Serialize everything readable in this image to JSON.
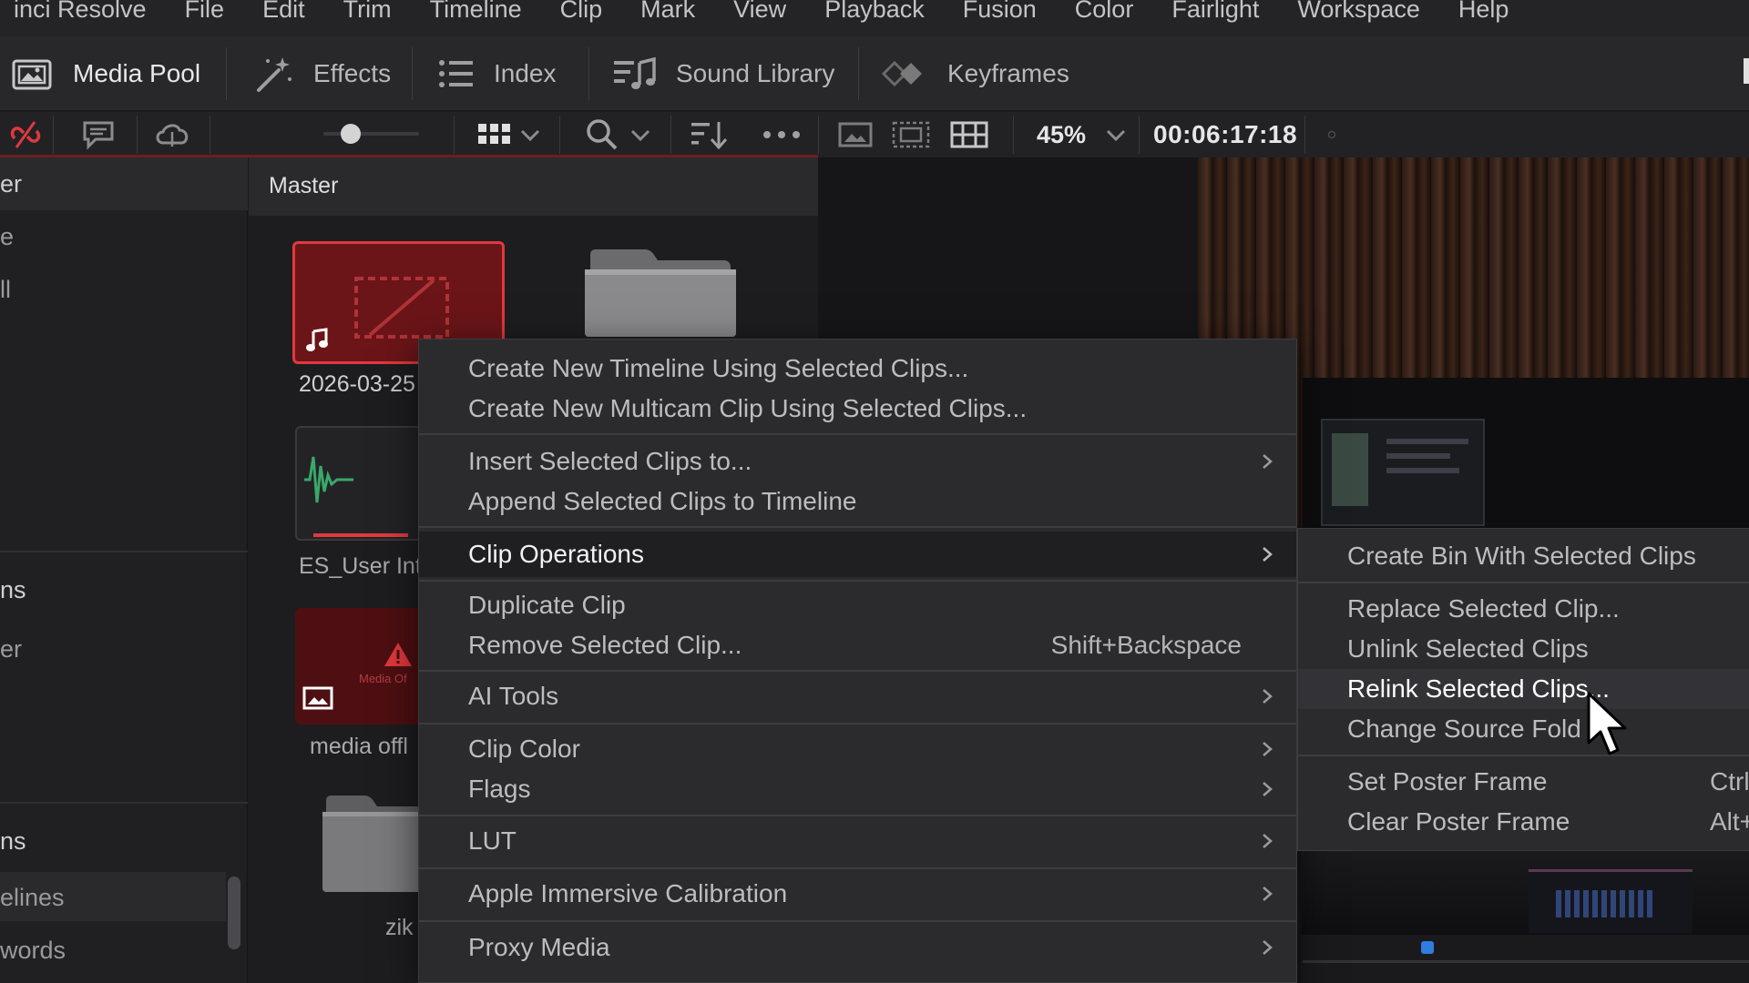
{
  "menubar": {
    "items": [
      "inci Resolve",
      "File",
      "Edit",
      "Trim",
      "Timeline",
      "Clip",
      "Mark",
      "View",
      "Playback",
      "Fusion",
      "Color",
      "Fairlight",
      "Workspace",
      "Help"
    ]
  },
  "toolbar": {
    "media_pool": "Media Pool",
    "effects": "Effects",
    "index": "Index",
    "sound_library": "Sound Library",
    "keyframes": "Keyframes"
  },
  "subbar": {
    "zoom": "45%",
    "timecode": "00:06:17:18"
  },
  "sidebar": {
    "texts": [
      "er",
      "e",
      "ll",
      "ns",
      "er",
      "ns",
      "elines",
      "words"
    ]
  },
  "pool": {
    "title": "Master",
    "clips": [
      {
        "label": "2026-03-25"
      },
      {
        "label": "ES_User Int"
      },
      {
        "label": "media offl"
      },
      {
        "label": "zik"
      }
    ],
    "offline_text": "Media Of"
  },
  "context_menu": {
    "items": [
      {
        "label": "Create New Timeline Using Selected Clips...",
        "shortcut": "",
        "submenu": false
      },
      {
        "label": "Create New Multicam Clip Using Selected Clips...",
        "shortcut": "",
        "submenu": false
      },
      {
        "label": "Insert Selected Clips to...",
        "shortcut": "",
        "submenu": true
      },
      {
        "label": "Append Selected Clips to Timeline",
        "shortcut": "",
        "submenu": false
      },
      {
        "label": "Clip Operations",
        "shortcut": "",
        "submenu": true
      },
      {
        "label": "Duplicate Clip",
        "shortcut": "",
        "submenu": false
      },
      {
        "label": "Remove Selected Clip...",
        "shortcut": "Shift+Backspace",
        "submenu": false
      },
      {
        "label": "AI Tools",
        "shortcut": "",
        "submenu": true
      },
      {
        "label": "Clip Color",
        "shortcut": "",
        "submenu": true
      },
      {
        "label": "Flags",
        "shortcut": "",
        "submenu": true
      },
      {
        "label": "LUT",
        "shortcut": "",
        "submenu": true
      },
      {
        "label": "Apple Immersive Calibration",
        "shortcut": "",
        "submenu": true
      },
      {
        "label": "Proxy Media",
        "shortcut": "",
        "submenu": true
      }
    ]
  },
  "submenu": {
    "items": [
      {
        "label": "Create Bin With Selected Clips",
        "shortcut": ""
      },
      {
        "label": "Replace Selected Clip...",
        "shortcut": ""
      },
      {
        "label": "Unlink Selected Clips",
        "shortcut": ""
      },
      {
        "label": "Relink Selected Clips...",
        "shortcut": ""
      },
      {
        "label": "Change Source Fold",
        "shortcut": ""
      },
      {
        "label": "Set Poster Frame",
        "shortcut": "Ctrl"
      },
      {
        "label": "Clear Poster Frame",
        "shortcut": "Alt+"
      }
    ]
  },
  "colors": {
    "accent_red": "#e0393e",
    "selection_blue": "#2f7de0",
    "menu_bg": "#2b2b2e"
  }
}
